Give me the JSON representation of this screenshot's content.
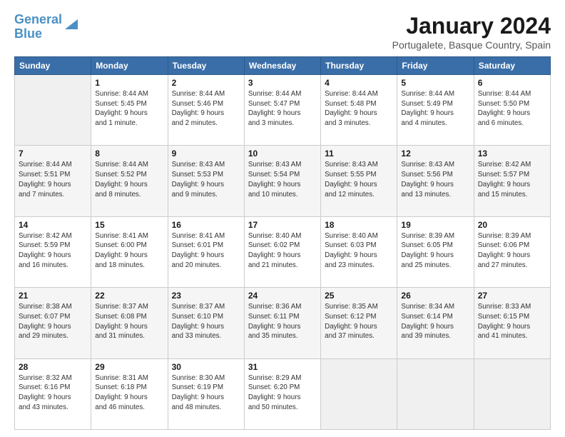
{
  "logo": {
    "line1": "General",
    "line2": "Blue"
  },
  "title": {
    "month": "January 2024",
    "location": "Portugalete, Basque Country, Spain"
  },
  "weekdays": [
    "Sunday",
    "Monday",
    "Tuesday",
    "Wednesday",
    "Thursday",
    "Friday",
    "Saturday"
  ],
  "weeks": [
    [
      {
        "day": "",
        "info": ""
      },
      {
        "day": "1",
        "info": "Sunrise: 8:44 AM\nSunset: 5:45 PM\nDaylight: 9 hours\nand 1 minute."
      },
      {
        "day": "2",
        "info": "Sunrise: 8:44 AM\nSunset: 5:46 PM\nDaylight: 9 hours\nand 2 minutes."
      },
      {
        "day": "3",
        "info": "Sunrise: 8:44 AM\nSunset: 5:47 PM\nDaylight: 9 hours\nand 3 minutes."
      },
      {
        "day": "4",
        "info": "Sunrise: 8:44 AM\nSunset: 5:48 PM\nDaylight: 9 hours\nand 3 minutes."
      },
      {
        "day": "5",
        "info": "Sunrise: 8:44 AM\nSunset: 5:49 PM\nDaylight: 9 hours\nand 4 minutes."
      },
      {
        "day": "6",
        "info": "Sunrise: 8:44 AM\nSunset: 5:50 PM\nDaylight: 9 hours\nand 6 minutes."
      }
    ],
    [
      {
        "day": "7",
        "info": "Sunrise: 8:44 AM\nSunset: 5:51 PM\nDaylight: 9 hours\nand 7 minutes."
      },
      {
        "day": "8",
        "info": "Sunrise: 8:44 AM\nSunset: 5:52 PM\nDaylight: 9 hours\nand 8 minutes."
      },
      {
        "day": "9",
        "info": "Sunrise: 8:43 AM\nSunset: 5:53 PM\nDaylight: 9 hours\nand 9 minutes."
      },
      {
        "day": "10",
        "info": "Sunrise: 8:43 AM\nSunset: 5:54 PM\nDaylight: 9 hours\nand 10 minutes."
      },
      {
        "day": "11",
        "info": "Sunrise: 8:43 AM\nSunset: 5:55 PM\nDaylight: 9 hours\nand 12 minutes."
      },
      {
        "day": "12",
        "info": "Sunrise: 8:43 AM\nSunset: 5:56 PM\nDaylight: 9 hours\nand 13 minutes."
      },
      {
        "day": "13",
        "info": "Sunrise: 8:42 AM\nSunset: 5:57 PM\nDaylight: 9 hours\nand 15 minutes."
      }
    ],
    [
      {
        "day": "14",
        "info": "Sunrise: 8:42 AM\nSunset: 5:59 PM\nDaylight: 9 hours\nand 16 minutes."
      },
      {
        "day": "15",
        "info": "Sunrise: 8:41 AM\nSunset: 6:00 PM\nDaylight: 9 hours\nand 18 minutes."
      },
      {
        "day": "16",
        "info": "Sunrise: 8:41 AM\nSunset: 6:01 PM\nDaylight: 9 hours\nand 20 minutes."
      },
      {
        "day": "17",
        "info": "Sunrise: 8:40 AM\nSunset: 6:02 PM\nDaylight: 9 hours\nand 21 minutes."
      },
      {
        "day": "18",
        "info": "Sunrise: 8:40 AM\nSunset: 6:03 PM\nDaylight: 9 hours\nand 23 minutes."
      },
      {
        "day": "19",
        "info": "Sunrise: 8:39 AM\nSunset: 6:05 PM\nDaylight: 9 hours\nand 25 minutes."
      },
      {
        "day": "20",
        "info": "Sunrise: 8:39 AM\nSunset: 6:06 PM\nDaylight: 9 hours\nand 27 minutes."
      }
    ],
    [
      {
        "day": "21",
        "info": "Sunrise: 8:38 AM\nSunset: 6:07 PM\nDaylight: 9 hours\nand 29 minutes."
      },
      {
        "day": "22",
        "info": "Sunrise: 8:37 AM\nSunset: 6:08 PM\nDaylight: 9 hours\nand 31 minutes."
      },
      {
        "day": "23",
        "info": "Sunrise: 8:37 AM\nSunset: 6:10 PM\nDaylight: 9 hours\nand 33 minutes."
      },
      {
        "day": "24",
        "info": "Sunrise: 8:36 AM\nSunset: 6:11 PM\nDaylight: 9 hours\nand 35 minutes."
      },
      {
        "day": "25",
        "info": "Sunrise: 8:35 AM\nSunset: 6:12 PM\nDaylight: 9 hours\nand 37 minutes."
      },
      {
        "day": "26",
        "info": "Sunrise: 8:34 AM\nSunset: 6:14 PM\nDaylight: 9 hours\nand 39 minutes."
      },
      {
        "day": "27",
        "info": "Sunrise: 8:33 AM\nSunset: 6:15 PM\nDaylight: 9 hours\nand 41 minutes."
      }
    ],
    [
      {
        "day": "28",
        "info": "Sunrise: 8:32 AM\nSunset: 6:16 PM\nDaylight: 9 hours\nand 43 minutes."
      },
      {
        "day": "29",
        "info": "Sunrise: 8:31 AM\nSunset: 6:18 PM\nDaylight: 9 hours\nand 46 minutes."
      },
      {
        "day": "30",
        "info": "Sunrise: 8:30 AM\nSunset: 6:19 PM\nDaylight: 9 hours\nand 48 minutes."
      },
      {
        "day": "31",
        "info": "Sunrise: 8:29 AM\nSunset: 6:20 PM\nDaylight: 9 hours\nand 50 minutes."
      },
      {
        "day": "",
        "info": ""
      },
      {
        "day": "",
        "info": ""
      },
      {
        "day": "",
        "info": ""
      }
    ]
  ]
}
